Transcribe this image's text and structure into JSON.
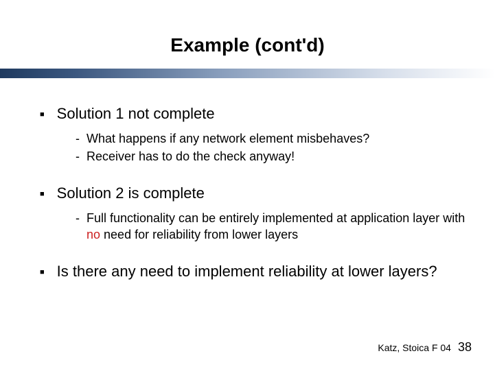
{
  "title": "Example (cont'd)",
  "bullets": [
    {
      "text": "Solution 1 not complete",
      "sub": [
        {
          "plain": "What happens if any network element misbehaves?"
        },
        {
          "plain": "Receiver has to do the check anyway!"
        }
      ]
    },
    {
      "text": "Solution 2 is complete",
      "sub": [
        {
          "before": "Full functionality can be entirely implemented at application layer with ",
          "highlight": "no",
          "after": " need for reliability from lower layers"
        }
      ]
    },
    {
      "text": "Is there any need to implement reliability at lower layers?",
      "sub": []
    }
  ],
  "footer": {
    "credit": "Katz, Stoica F 04",
    "page": "38"
  },
  "glyph": {
    "square": "■",
    "dash": "-"
  }
}
